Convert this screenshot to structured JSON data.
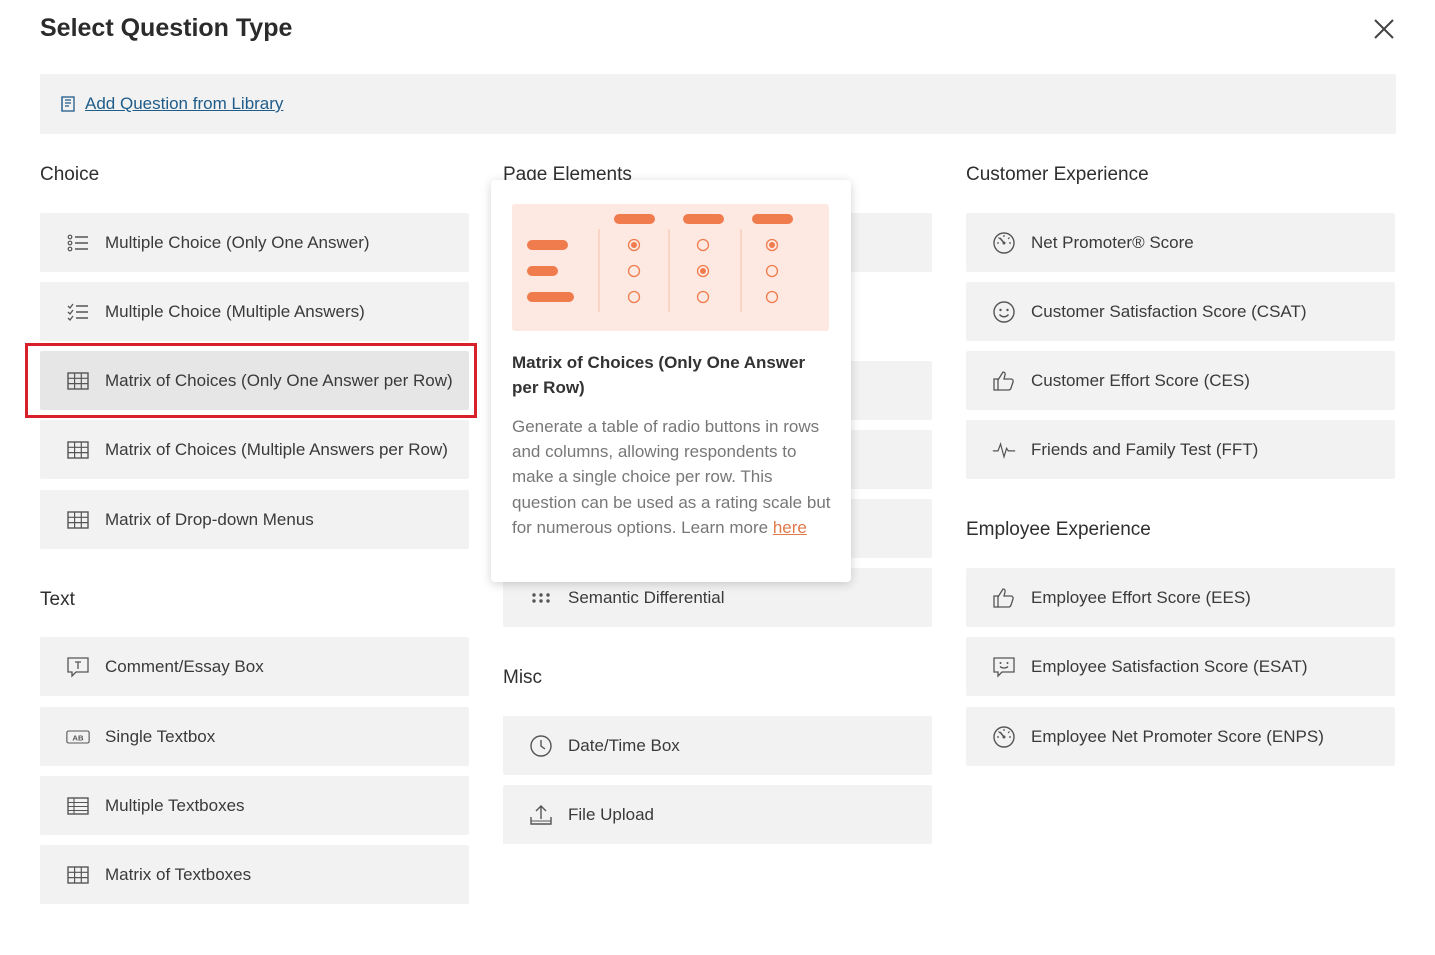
{
  "dialog": {
    "title": "Select Question Type",
    "library_link": "Add Question from Library"
  },
  "sections": {
    "choice": {
      "title": "Choice",
      "items": [
        {
          "label": "Multiple Choice (Only One Answer)",
          "icon": "numbered-list-icon"
        },
        {
          "label": "Multiple Choice (Multiple Answers)",
          "icon": "checklist-icon"
        },
        {
          "label": "Matrix of Choices (Only One Answer per Row)",
          "icon": "grid-icon"
        },
        {
          "label": "Matrix of Choices (Multiple Answers per Row)",
          "icon": "grid-icon"
        },
        {
          "label": "Matrix of Drop-down Menus",
          "icon": "grid-icon"
        }
      ]
    },
    "text": {
      "title": "Text",
      "items": [
        {
          "label": "Comment/Essay Box",
          "icon": "comment-text-icon"
        },
        {
          "label": "Single Textbox",
          "icon": "ab-textbox-icon"
        },
        {
          "label": "Multiple Textboxes",
          "icon": "table-icon"
        },
        {
          "label": "Matrix of Textboxes",
          "icon": "grid-icon"
        }
      ]
    },
    "page_elements": {
      "title": "Page Elements",
      "items": [
        {
          "label": "Semantic Differential",
          "icon": "dots-grid-icon"
        }
      ]
    },
    "misc": {
      "title": "Misc",
      "items": [
        {
          "label": "Date/Time Box",
          "icon": "clock-icon"
        },
        {
          "label": "File Upload",
          "icon": "upload-icon"
        }
      ]
    },
    "customer_experience": {
      "title": "Customer Experience",
      "items": [
        {
          "label": "Net Promoter® Score",
          "icon": "gauge-icon"
        },
        {
          "label": "Customer Satisfaction Score (CSAT)",
          "icon": "smiley-icon"
        },
        {
          "label": "Customer Effort Score (CES)",
          "icon": "thumbs-up-icon"
        },
        {
          "label": "Friends and Family Test (FFT)",
          "icon": "pulse-icon"
        }
      ]
    },
    "employee_experience": {
      "title": "Employee Experience",
      "items": [
        {
          "label": "Employee Effort Score (EES)",
          "icon": "thumbs-up-icon"
        },
        {
          "label": "Employee Satisfaction Score (ESAT)",
          "icon": "smiley-chat-icon"
        },
        {
          "label": "Employee Net Promoter Score (ENPS)",
          "icon": "gauge-icon"
        }
      ]
    }
  },
  "popover": {
    "title": "Matrix of Choices (Only One Answer per Row)",
    "description": "Generate a table of radio buttons in rows and columns, allowing respondents to make a single choice per row. This question can be used as a rating scale but for numerous options. Learn more ",
    "link_text": "here"
  },
  "colors": {
    "accent_orange": "#f07c4e",
    "illustration_bg": "#fde9e1",
    "highlight_red": "#d8202b",
    "link_blue": "#1f5c8a"
  }
}
